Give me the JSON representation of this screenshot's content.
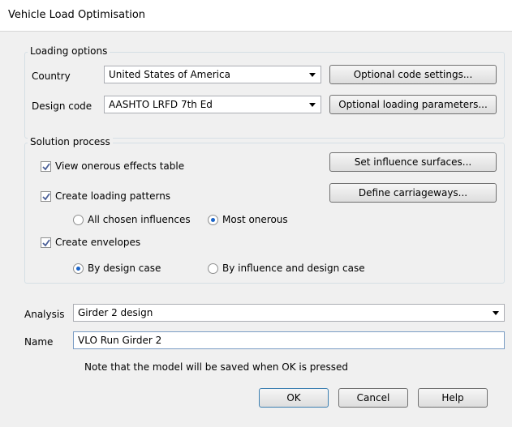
{
  "window": {
    "title": "Vehicle Load Optimisation"
  },
  "loading_options": {
    "group_title": "Loading options",
    "country_label": "Country",
    "country_value": "United States of America",
    "design_code_label": "Design code",
    "design_code_value": "AASHTO LRFD 7th Ed",
    "optional_code_settings_label": "Optional code settings...",
    "optional_loading_parameters_label": "Optional loading parameters..."
  },
  "solution_process": {
    "group_title": "Solution process",
    "view_onerous_label": "View onerous effects table",
    "view_onerous_checked": true,
    "create_patterns_label": "Create loading patterns",
    "create_patterns_checked": true,
    "all_chosen_label": "All chosen influences",
    "most_onerous_label": "Most onerous",
    "patterns_selected": "Most onerous",
    "create_envelopes_label": "Create envelopes",
    "create_envelopes_checked": true,
    "by_design_case_label": "By design case",
    "by_influence_label": "By influence and design case",
    "envelopes_selected": "By design case",
    "set_influence_surfaces_label": "Set influence surfaces...",
    "define_carriageways_label": "Define carriageways..."
  },
  "analysis": {
    "label": "Analysis",
    "value": "Girder 2 design"
  },
  "name": {
    "label": "Name",
    "value": "VLO Run Girder 2"
  },
  "note": "Note that the model will be saved when OK is pressed",
  "buttons": {
    "ok": "OK",
    "cancel": "Cancel",
    "help": "Help"
  }
}
